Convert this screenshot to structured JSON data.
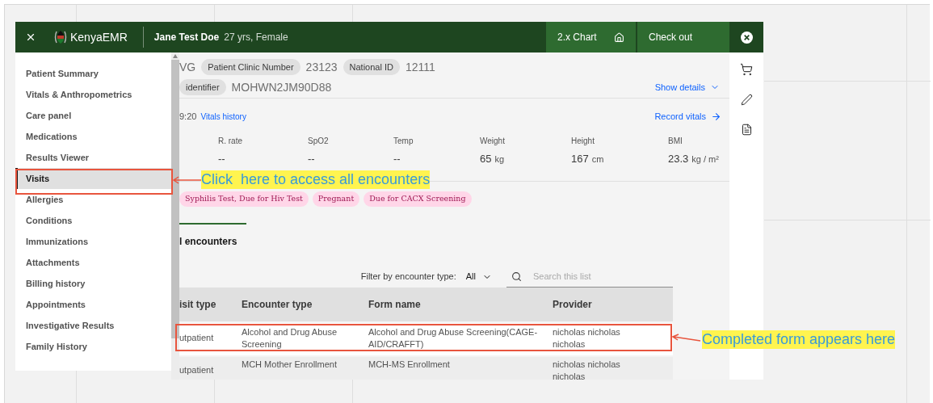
{
  "header": {
    "brand": "KenyaEMR",
    "patient_name": "Jane Test Doe",
    "patient_info": "27 yrs, Female",
    "chart_button": "2.x Chart",
    "checkout_button": "Check out"
  },
  "sidebar": {
    "items": [
      {
        "label": "Patient Summary",
        "selected": false
      },
      {
        "label": "Vitals & Anthropometrics",
        "selected": false
      },
      {
        "label": "Care panel",
        "selected": false
      },
      {
        "label": "Medications",
        "selected": false
      },
      {
        "label": "Results Viewer",
        "selected": false
      },
      {
        "label": "Visits",
        "selected": true
      },
      {
        "label": "Allergies",
        "selected": false
      },
      {
        "label": "Conditions",
        "selected": false
      },
      {
        "label": "Immunizations",
        "selected": false
      },
      {
        "label": "Attachments",
        "selected": false
      },
      {
        "label": "Billing history",
        "selected": false
      },
      {
        "label": "Appointments",
        "selected": false
      },
      {
        "label": "Investigative Results",
        "selected": false
      },
      {
        "label": "Family History",
        "selected": false
      }
    ]
  },
  "identifiers": {
    "row_1": [
      {
        "kind": "plain",
        "text": "VG"
      },
      {
        "kind": "chip",
        "text": "Patient Clinic Number"
      },
      {
        "kind": "value",
        "text": "23123"
      },
      {
        "kind": "chip",
        "text": "National ID"
      },
      {
        "kind": "value",
        "text": "12111"
      }
    ],
    "row_2": [
      {
        "kind": "chip",
        "text": "identifier"
      },
      {
        "kind": "value",
        "text": "MOHWN2JM90D88"
      }
    ],
    "show_details": "Show details"
  },
  "vitals": {
    "time": "9:20",
    "history_link": "Vitals history",
    "record_link": "Record vitals",
    "items": [
      {
        "label": "R. rate",
        "value": "--"
      },
      {
        "label": "SpO2",
        "value": "--"
      },
      {
        "label": "Temp",
        "value": "--"
      },
      {
        "label": "Weight",
        "value": "65",
        "unit": "kg"
      },
      {
        "label": "Height",
        "value": "167",
        "unit": "cm"
      },
      {
        "label": "BMI",
        "value": "23.3",
        "unit": "kg / m²"
      }
    ]
  },
  "flags": [
    "Syphilis Test, Due for Hiv Test",
    "Pregnant",
    "Due for CACX Screening"
  ],
  "encounters": {
    "title": "l encounters",
    "filter_label": "Filter by encounter type:",
    "filter_value": "All",
    "search_placeholder": "Search this list",
    "columns": [
      "isit type",
      "Encounter type",
      "Form name",
      "Provider"
    ],
    "rows": [
      {
        "cells": [
          "utpatient",
          "Alcohol and Drug Abuse Screening",
          "Alcohol and Drug Abuse Screening(CAGE-AID/CRAFFT)",
          "nicholas nicholas nicholas"
        ],
        "highlighted": true
      },
      {
        "cells": [
          "utpatient",
          "MCH Mother Enrollment",
          "MCH-MS Enrollment",
          "nicholas nicholas nicholas"
        ],
        "highlighted": false
      }
    ]
  },
  "annotations": [
    {
      "text": "Click  here to access all encounters"
    },
    {
      "text": "Completed form appears here"
    }
  ]
}
